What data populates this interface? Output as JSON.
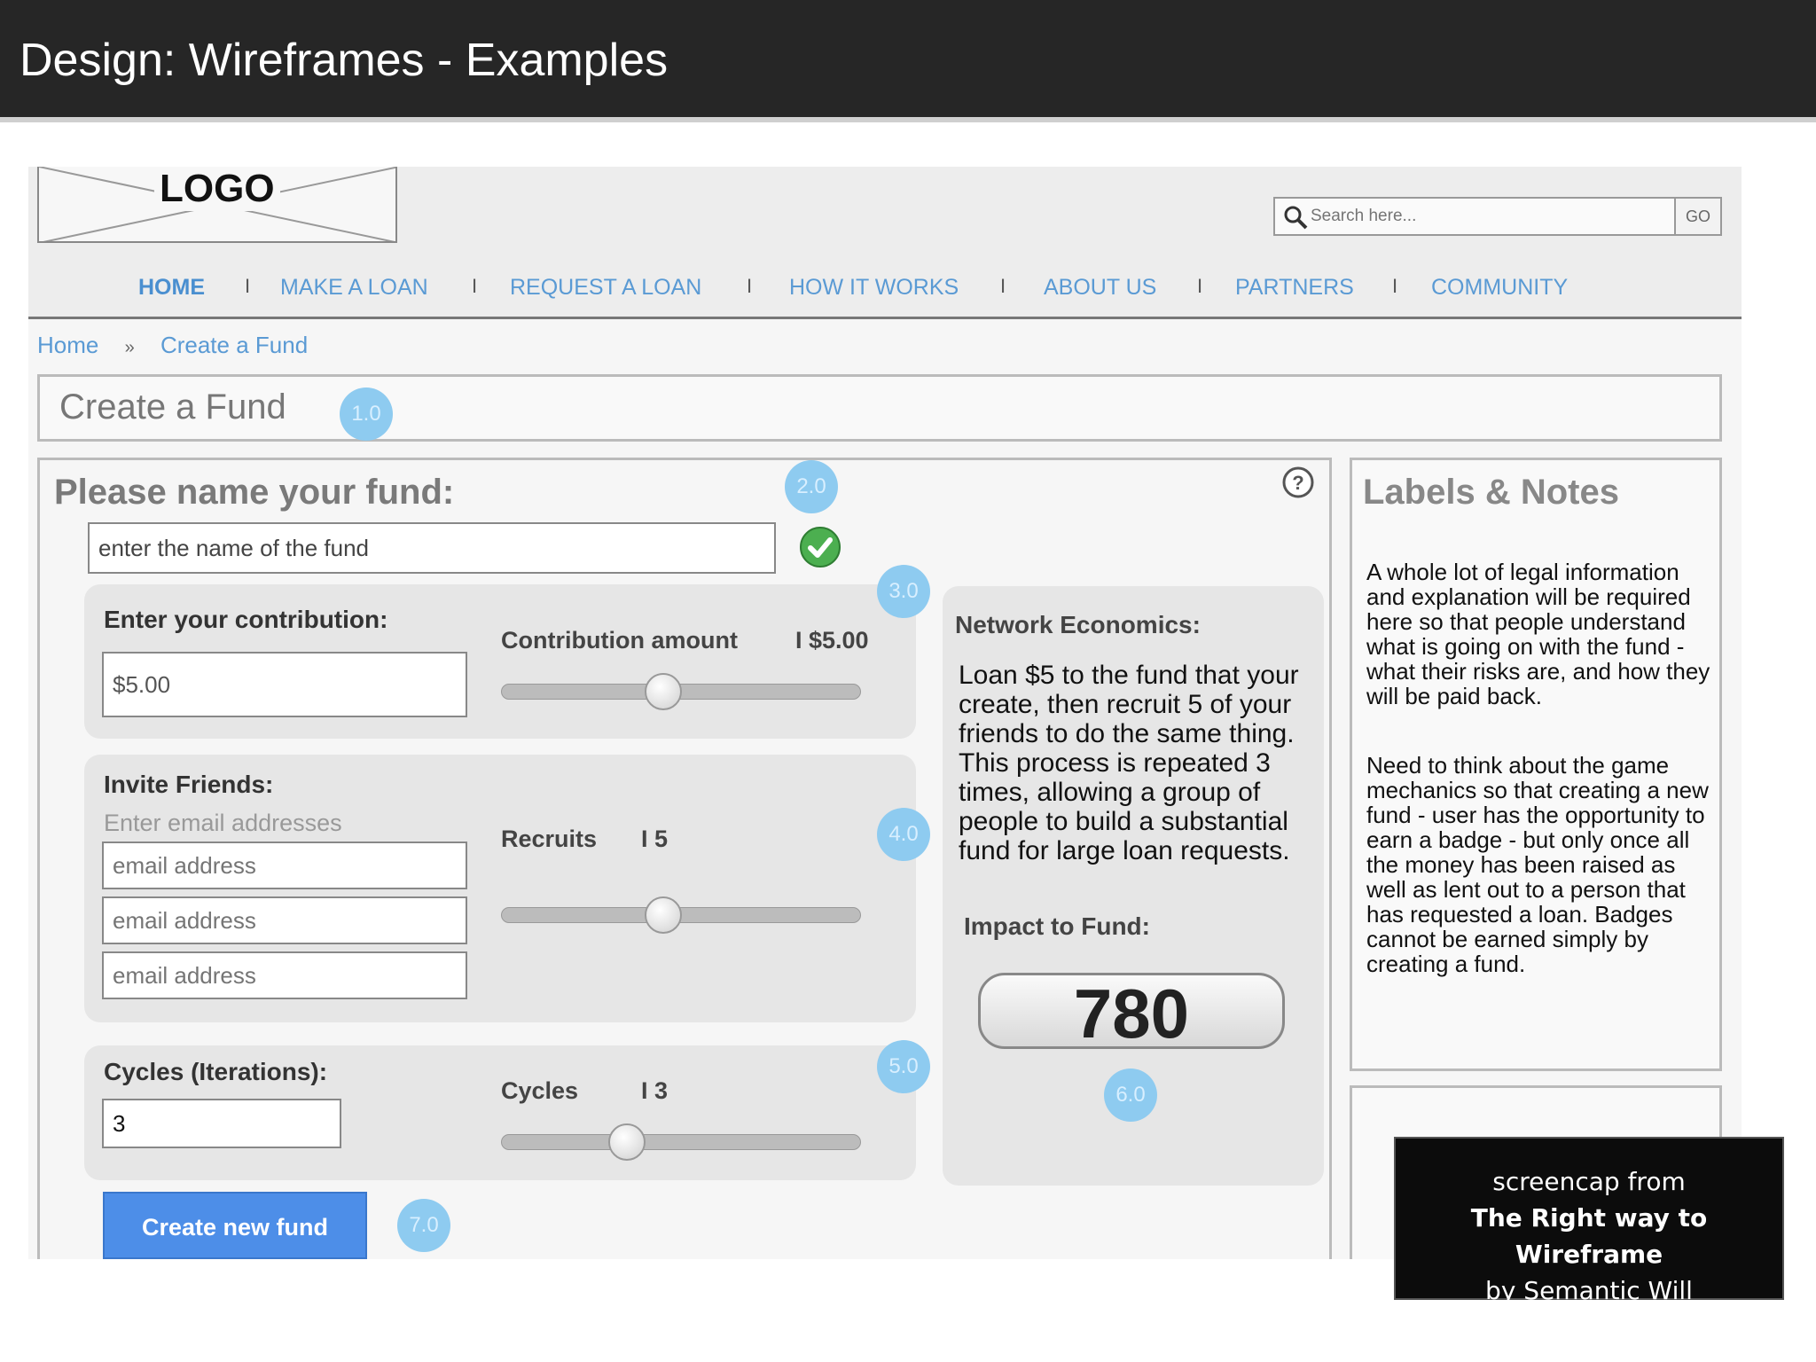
{
  "slide": {
    "title": "Design: Wireframes - Examples"
  },
  "wireframe": {
    "logo": "LOGO",
    "search": {
      "placeholder": "Search here...",
      "go_label": "GO"
    },
    "nav": [
      "HOME",
      "MAKE A LOAN",
      "REQUEST A LOAN",
      "HOW IT WORKS",
      "ABOUT US",
      "PARTNERS",
      "COMMUNITY"
    ],
    "nav_separator": "I",
    "breadcrumb": {
      "home": "Home",
      "separator": "»",
      "current": "Create a Fund"
    },
    "page_title": "Create a Fund",
    "badges": [
      "1.0",
      "2.0",
      "3.0",
      "4.0",
      "5.0",
      "6.0",
      "7.0"
    ],
    "fund_name": {
      "label": "Please name your fund:",
      "value": "enter the name of the fund"
    },
    "contribution": {
      "label": "Enter your contribution:",
      "value": "$5.00",
      "slider_label": "Contribution amount",
      "slider_value": "I $5.00",
      "slider_level": 0.45
    },
    "invite": {
      "label": "Invite Friends:",
      "sublabel": "Enter email addresses",
      "email_placeholders": [
        "email address",
        "email address",
        "email address"
      ],
      "slider_label": "Recruits",
      "slider_value": "I 5",
      "slider_level": 0.45
    },
    "cycles": {
      "label": "Cycles (Iterations):",
      "value": "3",
      "slider_label": "Cycles",
      "slider_value": "I 3",
      "slider_level": 0.35
    },
    "network": {
      "title": "Network Economics:",
      "body": "Loan $5 to the fund that your create, then recruit 5 of your friends to do the same thing. This process is repeated 3 times, allowing a group of people to build a substantial fund for large loan requests.",
      "impact_label": "Impact to Fund:",
      "impact_value": "780"
    },
    "create_button": "Create new fund",
    "notes": {
      "title": "Labels & Notes",
      "p1": "A whole lot of legal information and explanation will be required here so that people understand what is going on with the fund - what their risks are, and how they will be paid back.",
      "p2": "Need to think about the game mechanics so that creating a new fund - user has the opportunity to earn a badge - but only once all the money has been raised as well as lent out to a person that has requested a loan. Badges cannot be earned simply by creating a fund."
    },
    "colors": {
      "link": "#5a9ad4",
      "badge": "#8ecbf0",
      "button": "#4d8ee8",
      "check": "#4caf50"
    }
  },
  "credit": {
    "line1": "screencap from",
    "line2": "The Right way to Wireframe",
    "line3": "by Semantic Will"
  }
}
